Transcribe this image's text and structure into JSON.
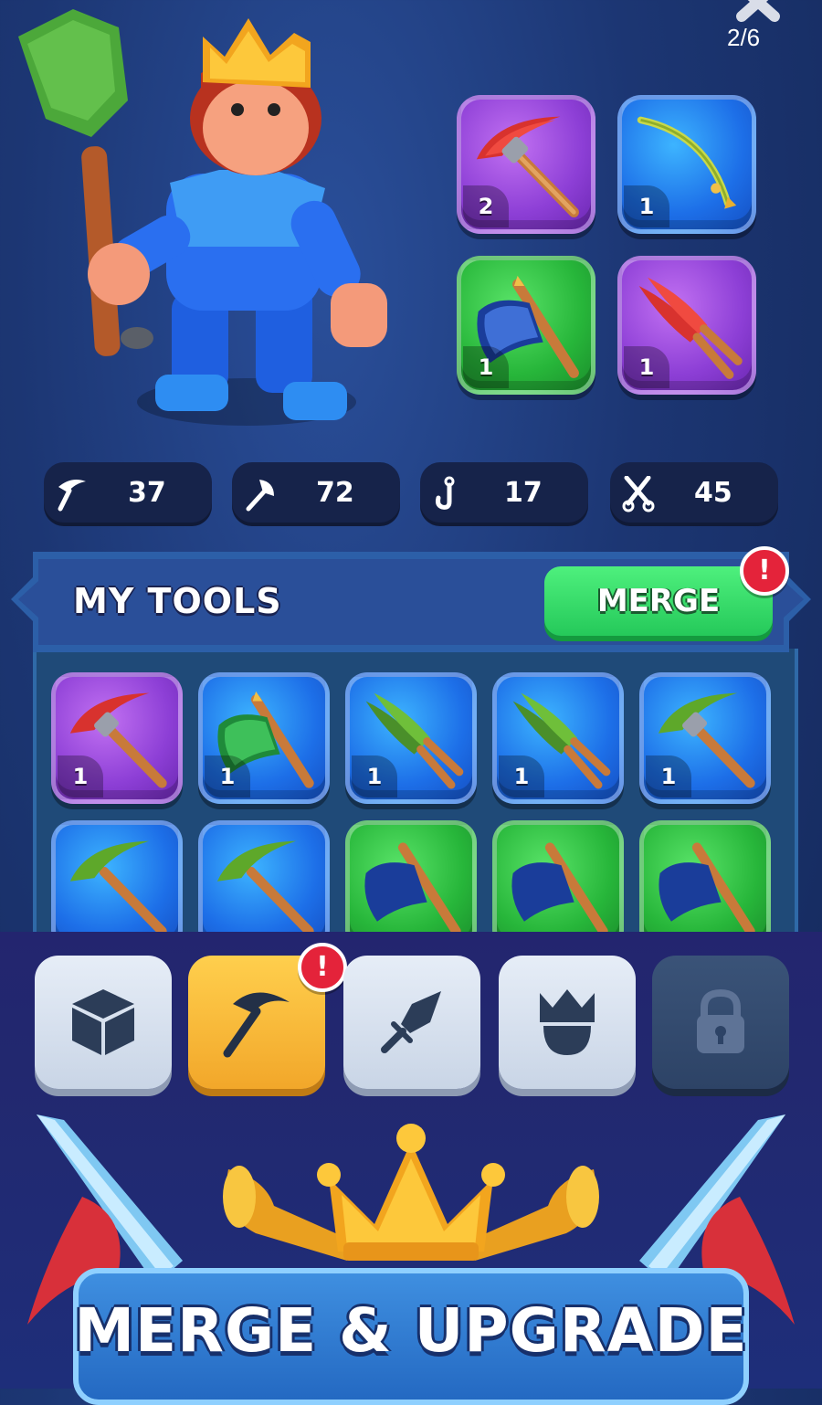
{
  "page_counter": "2/6",
  "equipped": [
    {
      "tool": "pickaxe",
      "rarity": "purple",
      "level": "2"
    },
    {
      "tool": "fishing-rod",
      "rarity": "blue",
      "level": "1"
    },
    {
      "tool": "axe",
      "rarity": "green",
      "level": "1"
    },
    {
      "tool": "shears",
      "rarity": "purple",
      "level": "1"
    }
  ],
  "stats": [
    {
      "icon": "pickaxe-icon",
      "value": "37"
    },
    {
      "icon": "axe-icon",
      "value": "72"
    },
    {
      "icon": "hook-icon",
      "value": "17"
    },
    {
      "icon": "scissors-icon",
      "value": "45"
    }
  ],
  "tools_panel": {
    "title": "MY TOOLS",
    "merge_label": "MERGE",
    "merge_alert": "!",
    "row1": [
      {
        "tool": "pickaxe",
        "rarity": "purple",
        "level": "1"
      },
      {
        "tool": "axe",
        "rarity": "blue",
        "level": "1"
      },
      {
        "tool": "shears",
        "rarity": "blue",
        "level": "1"
      },
      {
        "tool": "shears",
        "rarity": "blue",
        "level": "1"
      },
      {
        "tool": "pickaxe",
        "rarity": "blue",
        "level": "1"
      }
    ],
    "row2": [
      {
        "tool": "pickaxe",
        "rarity": "blue"
      },
      {
        "tool": "pickaxe",
        "rarity": "blue"
      },
      {
        "tool": "axe",
        "rarity": "green"
      },
      {
        "tool": "axe",
        "rarity": "green"
      },
      {
        "tool": "axe",
        "rarity": "green"
      }
    ]
  },
  "nav": {
    "items": [
      {
        "icon": "cube-icon"
      },
      {
        "icon": "pickaxe-icon",
        "selected": true,
        "alert": "!"
      },
      {
        "icon": "sword-icon"
      },
      {
        "icon": "helmet-crown-icon"
      },
      {
        "icon": "lock-icon",
        "locked": true
      }
    ]
  },
  "banner": {
    "text": "MERGE & UPGRADE"
  },
  "colors": {
    "purple": "#8d3fd6",
    "blue": "#1d6fe8",
    "green": "#27b63a",
    "merge_green": "#25c95a",
    "alert_red": "#e4233a",
    "nav_selected": "#f2a72a"
  }
}
